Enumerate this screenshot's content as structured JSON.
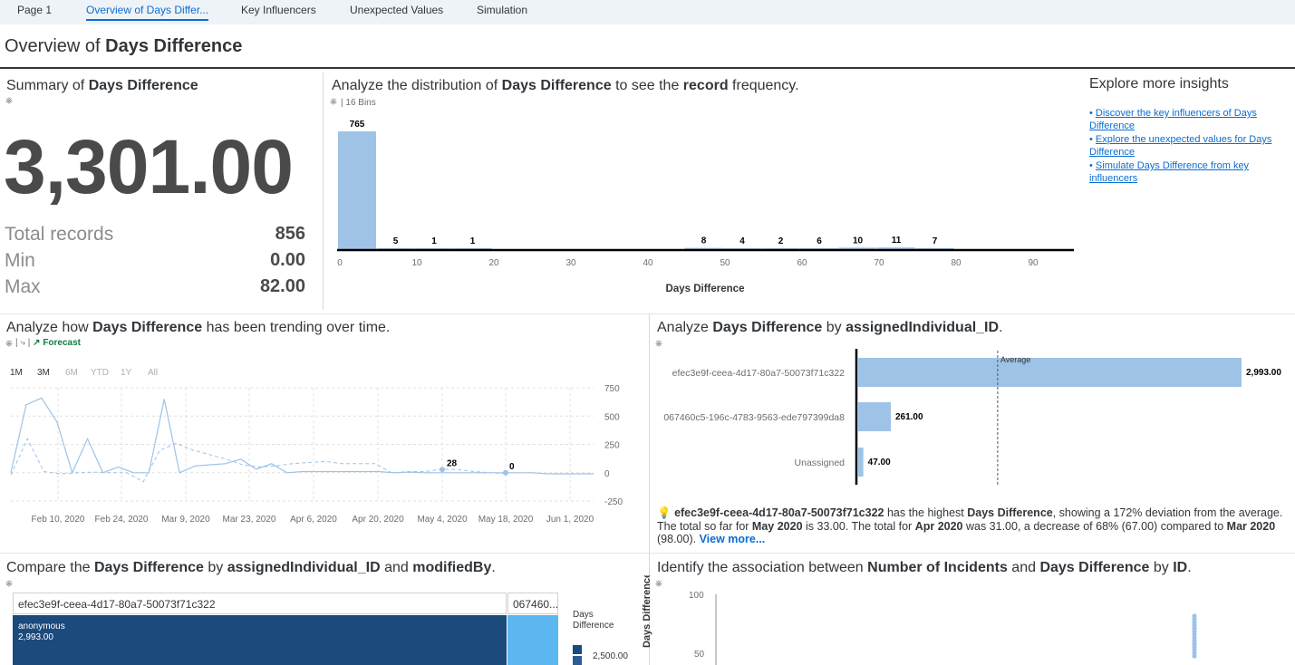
{
  "tabs": [
    "Page 1",
    "Overview of Days Differ...",
    "Key Influencers",
    "Unexpected Values",
    "Simulation"
  ],
  "page_title": {
    "prefix": "Overview of ",
    "bold": "Days Difference"
  },
  "summary": {
    "title_prefix": "Summary of ",
    "title_bold": "Days Difference",
    "big_value": "3,301.00",
    "total_label": "Total records",
    "total_value": "856",
    "min_label": "Min",
    "min_value": "0.00",
    "max_label": "Max",
    "max_value": "82.00"
  },
  "distribution": {
    "t1": "Analyze the distribution of ",
    "t2": "Days Difference",
    "t3": " to see the ",
    "t4": "record",
    "t5": " frequency.",
    "bins_label": "16 Bins",
    "xlabel": "Days Difference"
  },
  "insights": {
    "title": "Explore more insights",
    "links": [
      "Discover the key influencers of Days Difference",
      "Explore the unexpected values for Days Difference",
      "Simulate Days Difference from key influencers"
    ]
  },
  "trend": {
    "t1": "Analyze how ",
    "t2": "Days Difference",
    "t3": " has been trending over time.",
    "forecast_label": "Forecast",
    "ranges": [
      "1M",
      "3M",
      "6M",
      "YTD",
      "1Y",
      "All"
    ],
    "point_labels": [
      "28",
      "0"
    ]
  },
  "by_individual": {
    "t1": "Analyze ",
    "t2": "Days Difference",
    "t3": " by ",
    "t4": "assignedIndividual_ID",
    "t5": ".",
    "average_label": "Average"
  },
  "narrative": {
    "id": "efec3e9f-ceea-4d17-80a7-50073f71c322",
    "s1": " has the highest ",
    "measure": "Days Difference",
    "s2": ", showing a 172% deviation from the average. The total so far for ",
    "may": "May 2020",
    "s3": " is 33.00. The total for ",
    "apr": "Apr 2020",
    "s4": " was 31.00, a decrease of 68% (67.00) compared to ",
    "mar": "Mar 2020",
    "s5": " (98.00). ",
    "more": "View more..."
  },
  "compare": {
    "t1": "Compare the ",
    "t2": "Days Difference",
    "t3": " by ",
    "t4": "assignedIndividual_ID",
    "t5": " and ",
    "t6": "modifiedBy",
    "t7": ".",
    "header1": "efec3e9f-ceea-4d17-80a7-50073f71c322",
    "header2": "067460...",
    "cell_name": "anonymous",
    "cell_value": "2,993.00",
    "legend_title": "Days Difference",
    "legend_value": "2,500.00",
    "dark_color": "#1b4a7c",
    "light_color": "#5cb7f0"
  },
  "association": {
    "t1": "Identify the association between ",
    "t2": "Number of Incidents",
    "t3": " and ",
    "t4": "Days Difference",
    "t5": " by ",
    "t6": "ID",
    "t7": ".",
    "ylabel": "Days Difference",
    "yticks": [
      "100",
      "50"
    ]
  },
  "chart_data": [
    {
      "type": "bar",
      "title": "",
      "xlabel": "Days Difference",
      "ylabel": "",
      "bin_starts": [
        0,
        5,
        10,
        15,
        45,
        50,
        55,
        60,
        65,
        70,
        75
      ],
      "values": [
        765,
        5,
        1,
        1,
        8,
        4,
        2,
        6,
        10,
        11,
        7
      ],
      "xticks": [
        0,
        10,
        20,
        30,
        40,
        50,
        60,
        70,
        80,
        90
      ],
      "xlim": [
        0,
        95
      ],
      "bar_color": "#9ec3e6"
    },
    {
      "type": "line",
      "title": "",
      "xticks": [
        "Feb 10, 2020",
        "Feb 24, 2020",
        "Mar 9, 2020",
        "Mar 23, 2020",
        "Apr 6, 2020",
        "Apr 20, 2020",
        "May 4, 2020",
        "May 18, 2020",
        "Jun 1, 2020"
      ],
      "yticks": [
        750,
        500,
        250,
        0,
        -250
      ],
      "ylim": [
        -250,
        750
      ],
      "series": [
        {
          "values": [
            0,
            600,
            660,
            450,
            0,
            300,
            0,
            50,
            0,
            0,
            650,
            0,
            60,
            70,
            80,
            120,
            30,
            80,
            0,
            10,
            10,
            10,
            10,
            10,
            10,
            0,
            5,
            0,
            0,
            0,
            0,
            0,
            0,
            0,
            0,
            -10,
            -10,
            -10,
            -10
          ]
        },
        {
          "values": [
            -20,
            300,
            10,
            -10,
            0,
            5,
            0,
            0,
            -80,
            200,
            260,
            200,
            160,
            120,
            70,
            50,
            60,
            80,
            90,
            100,
            80,
            80,
            80,
            0,
            10,
            10,
            30,
            28,
            10,
            0,
            -10
          ]
        }
      ],
      "annotations": [
        {
          "label": "28",
          "y": 28
        },
        {
          "label": "0",
          "y": 0
        }
      ]
    },
    {
      "type": "bar",
      "orientation": "horizontal",
      "title": "",
      "categories": [
        "efec3e9f-ceea-4d17-80a7-50073f71c322",
        "067460c5-196c-4783-9563-ede797399da8",
        "Unassigned"
      ],
      "values": [
        2993,
        261,
        47
      ],
      "value_labels": [
        "2,993.00",
        "261.00",
        "47.00"
      ],
      "average": 1100.33,
      "xlim": [
        0,
        3000
      ],
      "bar_color": "#9ec3e6"
    },
    {
      "type": "scatter",
      "title": "",
      "ylabel": "Days Difference",
      "yticks": [
        100,
        50
      ],
      "ylim": [
        0,
        100
      ]
    }
  ]
}
